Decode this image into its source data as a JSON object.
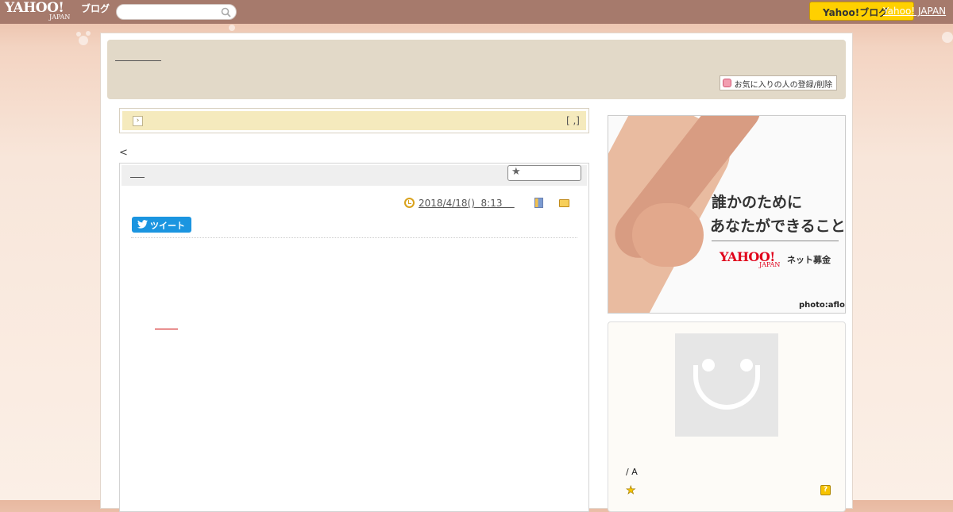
{
  "topbar": {
    "logo_text": "YAHOO!",
    "logo_sub": "JAPAN",
    "service_label": "ブログ",
    "search_placeholder": "",
    "yahoo_button_label": "Yahoo!ブログ",
    "yahoo_japan_link": "Yahoo! JAPAN"
  },
  "header": {
    "favorite_button_label": "お気に入りの人の登録/削除"
  },
  "notice": {
    "arrow_glyph": "›",
    "right_text": "[ ,]"
  },
  "article": {
    "prev_link": "<",
    "date_text": "2018/4/18()  8:13    ",
    "tweet_label": "ツイート"
  },
  "ad": {
    "line1": "誰かのために",
    "line2": "あなたができること",
    "logo_text": "YAHOO!",
    "logo_sub": "JAPAN",
    "service_label": "ネット募金",
    "credit": "photo:aflo"
  },
  "profile": {
    "name_text": "/ A",
    "star_glyph": "★",
    "help_glyph": "?"
  }
}
